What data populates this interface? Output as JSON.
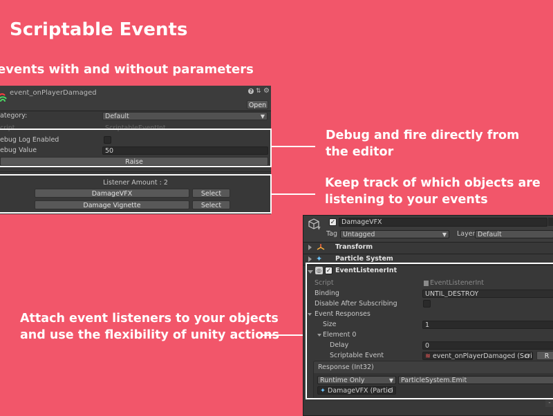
{
  "heading": {
    "title": "Scriptable Events",
    "subtitle": "events with and without parameters"
  },
  "callouts": {
    "debug_line1": "Debug  and fire directly from",
    "debug_line2": "the editor",
    "track_line1": "Keep track of which objects are",
    "track_line2": "listening to your events",
    "attach_line1": "Attach event listeners to your objects",
    "attach_line2": "and use the flexibility of unity actions"
  },
  "event_inspector": {
    "asset_name": "event_onPlayerDamaged",
    "open_label": "Open",
    "category_label": "ategory:",
    "category_value": "Default",
    "script_label": "cript",
    "script_value": "ScriptableEventInt",
    "debug_log_label": "ebug Log Enabled",
    "debug_value_label": "ebug Value",
    "debug_value": "50",
    "raise_label": "Raise",
    "listener_amount": "Listener Amount : 2",
    "listeners": [
      {
        "name": "DamageVFX",
        "select": "Select"
      },
      {
        "name": "Damage Vignette",
        "select": "Select"
      }
    ]
  },
  "gameobject_inspector": {
    "name": "DamageVFX",
    "tag_label": "Tag",
    "tag_value": "Untagged",
    "layer_label": "Layer",
    "layer_value": "Default",
    "components": [
      "Transform",
      "Particle System"
    ],
    "listener_component": "EventListenerInt",
    "script_label": "Script",
    "script_value": "EventListenerInt",
    "binding_label": "Binding",
    "binding_value": "UNTIL_DESTROY",
    "disable_label": "Disable After Subscribing",
    "event_responses_label": "Event Responses",
    "size_label": "Size",
    "size_value": "1",
    "element_label": "Element 0",
    "delay_label": "Delay",
    "delay_value": "0",
    "scriptable_event_label": "Scriptable Event",
    "scriptable_event_value": "event_onPlayerDamaged (Scrip",
    "r_button": "R",
    "response_label": "Response (Int32)",
    "runtime_value": "Runtime Only",
    "function_value": "ParticleSystem.Emit",
    "target_value": "DamageVFX (Particl"
  },
  "colors": {
    "background": "#f2566a",
    "panel": "#383838",
    "highlight": "#ffffff"
  }
}
